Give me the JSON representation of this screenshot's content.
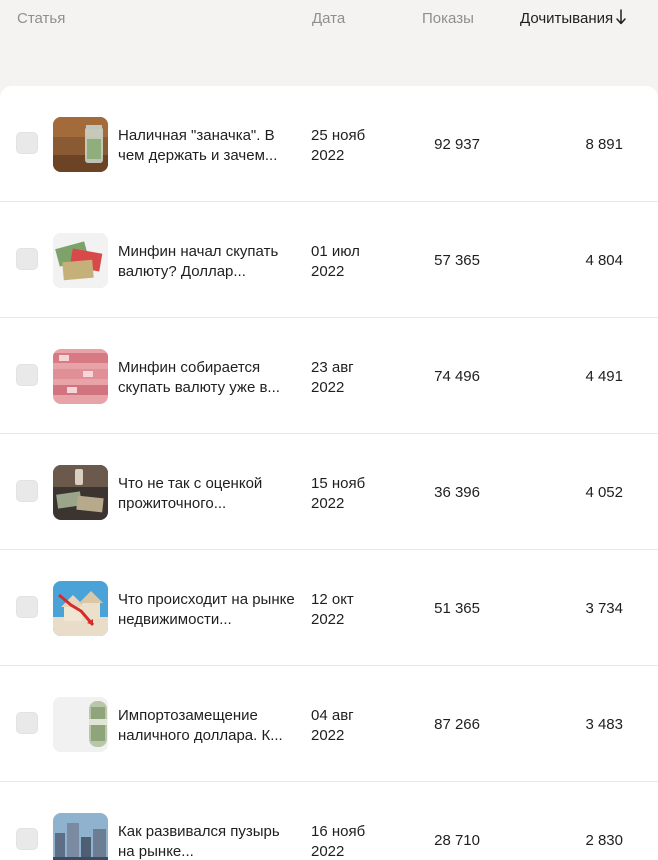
{
  "header": {
    "col_title": "Статья",
    "col_date": "Дата",
    "col_views": "Показы",
    "col_reads": "Дочитывания",
    "sort_icon": "arrow-down-icon"
  },
  "rows": [
    {
      "title": "Наличная \"заначка\". В чем держать и зачем...",
      "date_day": "25 нояб",
      "date_year": "2022",
      "views": "92 937",
      "reads": "8 891",
      "thumb_icon": "money-jar-thumbnail"
    },
    {
      "title": "Минфин начал скупать валюту? Доллар...",
      "date_day": "01 июл",
      "date_year": "2022",
      "views": "57 365",
      "reads": "4 804",
      "thumb_icon": "banknotes-thumbnail"
    },
    {
      "title": "Минфин собирается скупать валюту уже в...",
      "date_day": "23 авг",
      "date_year": "2022",
      "views": "74 496",
      "reads": "4 491",
      "thumb_icon": "yuan-banknotes-thumbnail"
    },
    {
      "title": "Что не так с оценкой прожиточного...",
      "date_day": "15 нояб",
      "date_year": "2022",
      "views": "36 396",
      "reads": "4 052",
      "thumb_icon": "rubles-on-table-thumbnail"
    },
    {
      "title": "Что происходит на рынке недвижимости...",
      "date_day": "12 окт",
      "date_year": "2022",
      "views": "51 365",
      "reads": "3 734",
      "thumb_icon": "house-falling-chart-thumbnail"
    },
    {
      "title": "Импортозамещение наличного доллара. К...",
      "date_day": "04 авг",
      "date_year": "2022",
      "views": "87 266",
      "reads": "3 483",
      "thumb_icon": "dollar-roll-thumbnail"
    },
    {
      "title": "Как развивался пузырь на рынке...",
      "date_day": "16 нояб",
      "date_year": "2022",
      "views": "28 710",
      "reads": "2 830",
      "thumb_icon": "city-buildings-thumbnail"
    }
  ]
}
